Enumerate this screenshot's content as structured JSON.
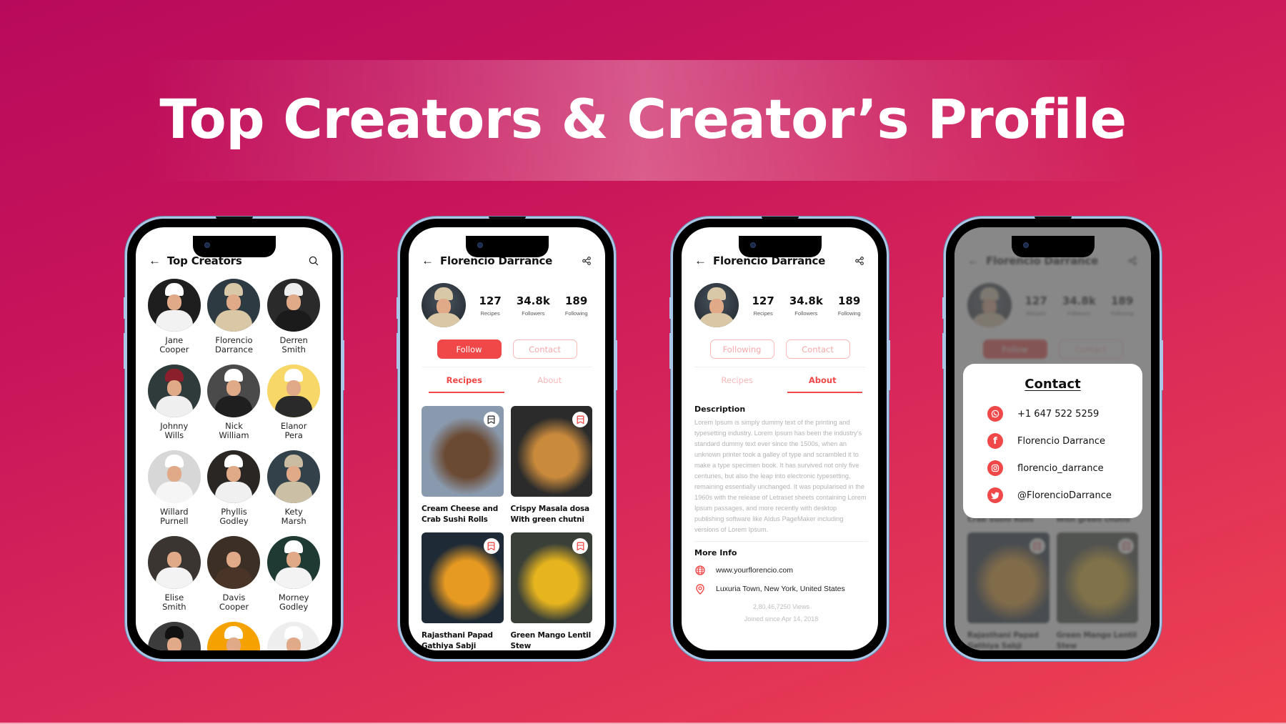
{
  "page": {
    "title": "Top Creators & Creator’s Profile"
  },
  "colors": {
    "accent": "#f04848",
    "accent_light": "#f7b8b8",
    "background_start": "#b80a5c",
    "background_end": "#ee4250"
  },
  "screen1": {
    "header": {
      "title": "Top Creators",
      "back_icon": "arrow-left-icon",
      "action_icon": "search-icon"
    },
    "creators": [
      {
        "first": "Jane",
        "last": "Cooper",
        "bg": "#1e1e1e",
        "apron": "#f2f2f2",
        "hat": "#ffffff"
      },
      {
        "first": "Florencio",
        "last": "Darrance",
        "bg": "#2d3a42",
        "apron": "#d9c7a6",
        "hat": "#d8c8a8"
      },
      {
        "first": "Derren",
        "last": "Smith",
        "bg": "#2a2a2a",
        "apron": "#1b1b1b",
        "hat": "#eeeeee"
      },
      {
        "first": "Johnny",
        "last": "Wills",
        "bg": "#2f3a3a",
        "apron": "#efefef",
        "hat": "#8b1f2b"
      },
      {
        "first": "Nick",
        "last": "William",
        "bg": "#4a4a4a",
        "apron": "#1f1f1f",
        "hat": "#ffffff"
      },
      {
        "first": "Elanor",
        "last": "Pera",
        "bg": "#f7d768",
        "apron": "#2a2a2a",
        "hat": "#ffffff"
      },
      {
        "first": "Willard",
        "last": "Purnell",
        "bg": "#d7d7d7",
        "apron": "#f5f5f5",
        "hat": "#ffffff"
      },
      {
        "first": "Phyllis",
        "last": "Godley",
        "bg": "#2a2624",
        "apron": "#f0f0f0",
        "hat": "#ffffff"
      },
      {
        "first": "Kety",
        "last": "Marsh",
        "bg": "#33414a",
        "apron": "#cbbfa6",
        "hat": "#c9bca2"
      },
      {
        "first": "Elise",
        "last": "Smith",
        "bg": "#3a3530",
        "apron": "#f3f3f3",
        "hat": "#3a3530"
      },
      {
        "first": "Davis",
        "last": "Cooper",
        "bg": "#3b2f26",
        "apron": "#4a3428",
        "hat": "#3b2f26"
      },
      {
        "first": "Morney",
        "last": "Godley",
        "bg": "#1e3a33",
        "apron": "#f3f3f3",
        "hat": "#ffffff"
      },
      {
        "first": "",
        "last": "",
        "bg": "#3c3c3c",
        "apron": "#111111",
        "hat": "#111111"
      },
      {
        "first": "",
        "last": "",
        "bg": "#f5a200",
        "apron": "#f5f5f5",
        "hat": "#ffffff"
      },
      {
        "first": "",
        "last": "",
        "bg": "#eeeeee",
        "apron": "#f5f5f5",
        "hat": "#ffffff"
      }
    ]
  },
  "profile": {
    "name": "Florencio Darrance",
    "back_icon": "arrow-left-icon",
    "share_icon": "share-icon",
    "stats": [
      {
        "value": "127",
        "label": "Recipes"
      },
      {
        "value": "34.8k",
        "label": "Followers"
      },
      {
        "value": "189",
        "label": "Following"
      }
    ],
    "follow_label": "Follow",
    "following_label": "Following",
    "contact_label": "Contact",
    "tabs": [
      {
        "label": "Recipes"
      },
      {
        "label": "About"
      }
    ]
  },
  "screen2": {
    "active_tab": "Recipes",
    "recipes": [
      {
        "line1": "Cream Cheese and",
        "line2": "Crab Sushi Rolls",
        "saved": true,
        "c1": "#8a9aae",
        "c2": "#6b4a33"
      },
      {
        "line1": "Crispy Masala dosa",
        "line2": "With green chutni",
        "saved": false,
        "c1": "#2b2b2b",
        "c2": "#c98a3c"
      },
      {
        "line1": "Rajasthani Papad",
        "line2": "Gathiya Sabji",
        "saved": false,
        "c1": "#1e2a36",
        "c2": "#e79a22"
      },
      {
        "line1": "Green Mango Lentil",
        "line2": "Stew",
        "saved": false,
        "c1": "#3a4038",
        "c2": "#e6b41e"
      }
    ]
  },
  "screen3": {
    "active_tab": "About",
    "description_title": "Description",
    "description": "Lorem Ipsum is simply dummy text of the printing and typesetting industry. Lorem Ipsum has been the industry’s standard dummy text ever since the 1500s, when an unknown printer took a galley of type and scrambled it to make a type specimen book. It has survived not only five centuries, but also the leap into electronic typesetting, remaining essentially unchanged. It was popularised in the 1960s with the release of Letraset sheets containing Lorem Ipsum passages, and more recently with desktop publishing software like Aldus PageMaker including versions of Lorem Ipsum.",
    "more_info_title": "More Info",
    "website": "www.yourflorencio.com",
    "location": "Luxuria Town, New York, United States",
    "views": "2,80,46,7250 Views",
    "joined": "Joined since Apr 14, 2018"
  },
  "screen4": {
    "contact_title": "Contact",
    "contacts": [
      {
        "icon": "whatsapp-icon",
        "glyph": "✆",
        "value": "+1 647 522 5259"
      },
      {
        "icon": "facebook-icon",
        "glyph": "f",
        "value": "Florencio Darrance"
      },
      {
        "icon": "instagram-icon",
        "glyph": "◎",
        "value": "florencio_darrance"
      },
      {
        "icon": "twitter-icon",
        "glyph": "🐦",
        "value": "@FlorencioDarrance"
      }
    ]
  }
}
